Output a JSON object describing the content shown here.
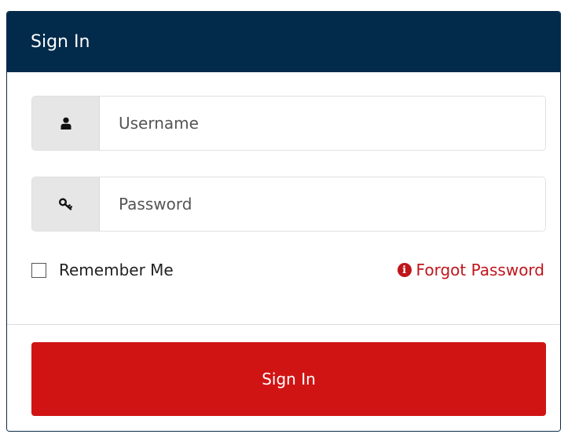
{
  "header": {
    "title": "Sign In"
  },
  "form": {
    "username": {
      "placeholder": "Username",
      "value": ""
    },
    "password": {
      "placeholder": "Password",
      "value": ""
    },
    "remember_label": "Remember Me",
    "remember_checked": false,
    "forgot_label": "Forgot Password"
  },
  "footer": {
    "signin_label": "Sign In"
  },
  "icons": {
    "username": "user-icon",
    "password": "key-icon",
    "forgot": "info-circle-icon"
  },
  "colors": {
    "header_bg": "#022a4a",
    "button_bg": "#d01414",
    "link": "#c0151b",
    "addon_bg": "#e6e6e6"
  }
}
